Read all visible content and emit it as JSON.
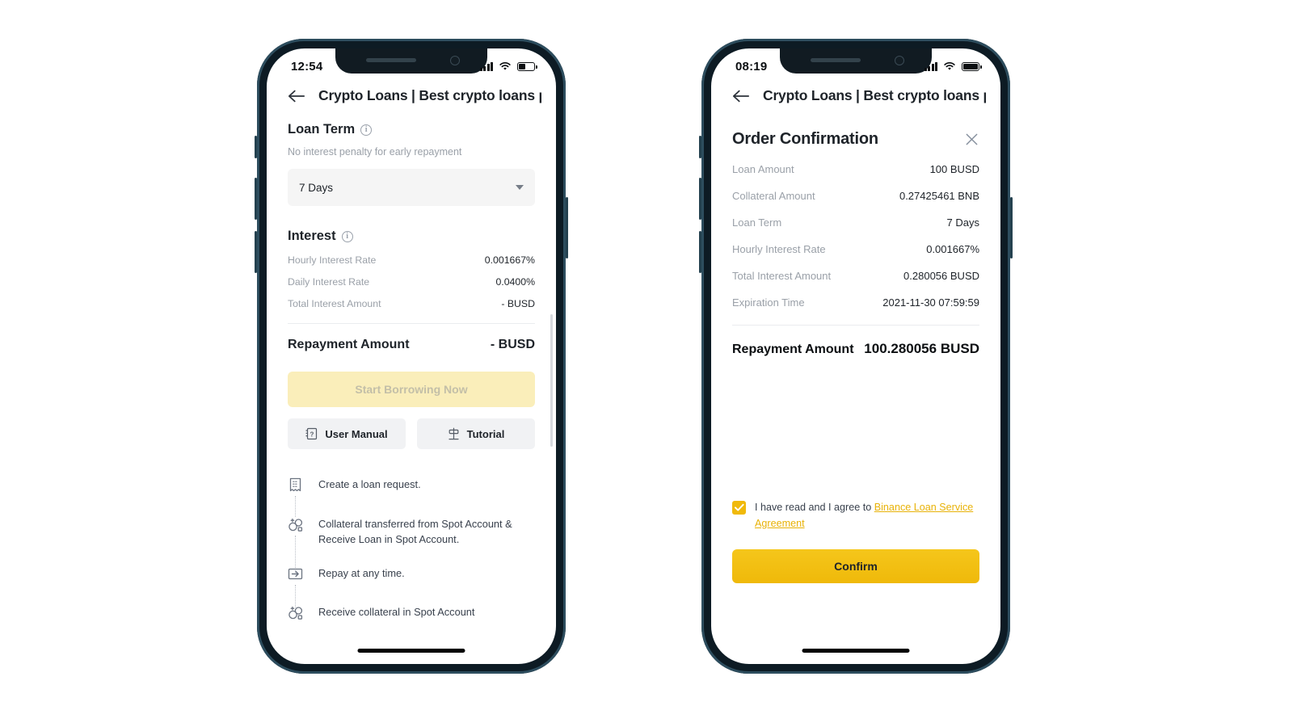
{
  "left_phone": {
    "status": {
      "time": "12:54",
      "battery_level": 45
    },
    "titlebar": {
      "back_icon": "back-arrow-icon",
      "title": "Crypto Loans | Best crypto loans plat..."
    },
    "loan_term": {
      "heading": "Loan Term",
      "info_icon": "info-icon",
      "note": "No interest penalty for early repayment",
      "selected": "7 Days",
      "caret_icon": "chevron-down-icon"
    },
    "interest": {
      "heading": "Interest",
      "info_icon": "info-icon",
      "rows": [
        {
          "label": "Hourly Interest Rate",
          "value": "0.001667%"
        },
        {
          "label": "Daily Interest Rate",
          "value": "0.0400%"
        },
        {
          "label": "Total Interest Amount",
          "value": "- BUSD"
        }
      ]
    },
    "repayment": {
      "label": "Repayment Amount",
      "value": "- BUSD"
    },
    "primary_button": {
      "label": "Start Borrowing Now",
      "disabled": true
    },
    "secondary_buttons": [
      {
        "label": "User Manual",
        "icon": "manual-book-icon"
      },
      {
        "label": "Tutorial",
        "icon": "signpost-icon"
      }
    ],
    "steps": [
      {
        "icon": "receipt-icon",
        "text": "Create a loan request."
      },
      {
        "icon": "transfer-coins-icon",
        "text": "Collateral transferred from Spot Account & Receive Loan in Spot Account."
      },
      {
        "icon": "arrow-right-box-icon",
        "text": "Repay at any time."
      },
      {
        "icon": "transfer-coins-icon",
        "text": "Receive collateral in Spot Account"
      }
    ]
  },
  "right_phone": {
    "status": {
      "time": "08:19",
      "battery_level": 100
    },
    "titlebar": {
      "back_icon": "back-arrow-icon",
      "title": "Crypto Loans | Best crypto loans plat..."
    },
    "order_confirmation": {
      "title": "Order Confirmation",
      "close_icon": "close-icon",
      "rows": [
        {
          "label": "Loan Amount",
          "value": "100 BUSD"
        },
        {
          "label": "Collateral Amount",
          "value": "0.27425461 BNB"
        },
        {
          "label": "Loan Term",
          "value": "7 Days"
        },
        {
          "label": "Hourly Interest Rate",
          "value": "0.001667%"
        },
        {
          "label": "Total Interest Amount",
          "value": "0.280056 BUSD"
        },
        {
          "label": "Expiration Time",
          "value": "2021-11-30 07:59:59"
        }
      ],
      "repayment": {
        "label": "Repayment Amount",
        "value": "100.280056 BUSD"
      },
      "agreement": {
        "checked": true,
        "text": "I have read and I agree to ",
        "link": "Binance Loan Service Agreement"
      },
      "confirm_button": {
        "label": "Confirm"
      }
    }
  },
  "colors": {
    "brand_yellow": "#f0b90b",
    "disabled_yellow": "#faeeba",
    "text_primary": "#1e2329",
    "text_muted": "#9aa0a8",
    "frame": "#0d1b24"
  }
}
